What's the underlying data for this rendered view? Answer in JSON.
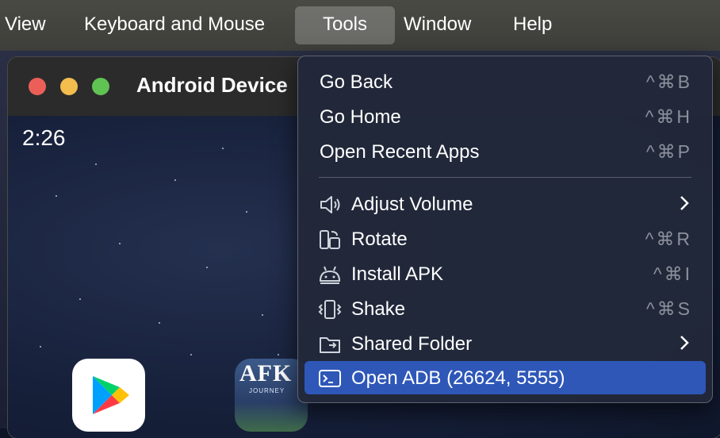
{
  "menubar": {
    "items": [
      {
        "label": "View"
      },
      {
        "label": "Keyboard and Mouse"
      },
      {
        "label": "Tools"
      },
      {
        "label": "Window"
      },
      {
        "label": "Help"
      }
    ]
  },
  "window": {
    "title": "Android Device",
    "clock": "2:26"
  },
  "apps": {
    "afk_label": "AFK",
    "afk_sub": "JOURNEY"
  },
  "tools_menu": {
    "items": [
      {
        "label": "Go Back",
        "shortcut": "^⌘B"
      },
      {
        "label": "Go Home",
        "shortcut": "^⌘H"
      },
      {
        "label": "Open Recent Apps",
        "shortcut": "^⌘P"
      },
      {
        "label": "Adjust Volume",
        "icon": "speaker-icon",
        "submenu": true
      },
      {
        "label": "Rotate",
        "icon": "rotate-icon",
        "shortcut": "^⌘R"
      },
      {
        "label": "Install APK",
        "icon": "android-icon",
        "shortcut": "^⌘I"
      },
      {
        "label": "Shake",
        "icon": "shake-icon",
        "shortcut": "^⌘S"
      },
      {
        "label": "Shared Folder",
        "icon": "folder-icon",
        "submenu": true
      },
      {
        "label": "Open ADB (26624, 5555)",
        "icon": "terminal-icon",
        "highlighted": true
      }
    ]
  },
  "colors": {
    "highlight": "#2e57b8",
    "menu_bg": "#22283a"
  }
}
